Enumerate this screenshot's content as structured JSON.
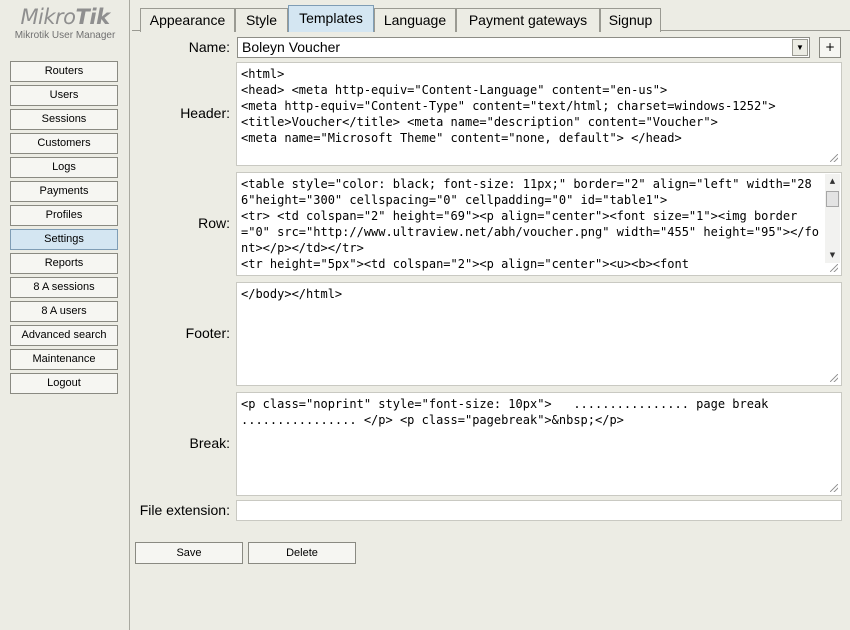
{
  "logo": {
    "brand_prefix": "Mikro",
    "brand_suffix": "Tik",
    "subtitle": "Mikrotik User Manager"
  },
  "sidebar": {
    "items": [
      {
        "label": "Routers"
      },
      {
        "label": "Users"
      },
      {
        "label": "Sessions"
      },
      {
        "label": "Customers"
      },
      {
        "label": "Logs"
      },
      {
        "label": "Payments"
      },
      {
        "label": "Profiles"
      },
      {
        "label": "Settings",
        "active": true
      },
      {
        "label": "Reports"
      },
      {
        "label": "8 A sessions"
      },
      {
        "label": "8 A users"
      },
      {
        "label": "Advanced search"
      },
      {
        "label": "Maintenance"
      },
      {
        "label": "Logout"
      }
    ]
  },
  "tabs": [
    {
      "label": "Appearance"
    },
    {
      "label": "Style"
    },
    {
      "label": "Templates",
      "active": true
    },
    {
      "label": "Language"
    },
    {
      "label": "Payment gateways"
    },
    {
      "label": "Signup"
    }
  ],
  "form": {
    "name_label": "Name:",
    "name_value": "Boleyn Voucher",
    "plus_label": "+",
    "header_label": "Header:",
    "header_value": "<html>\n<head> <meta http-equiv=\"Content-Language\" content=\"en-us\">\n<meta http-equiv=\"Content-Type\" content=\"text/html; charset=windows-1252\">\n<title>Voucher</title> <meta name=\"description\" content=\"Voucher\">\n<meta name=\"Microsoft Theme\" content=\"none, default\"> </head>",
    "row_label": "Row:",
    "row_value": "<table style=\"color: black; font-size: 11px;\" border=\"2\" align=\"left\" width=\"286\"height=\"300\" cellspacing=\"0\" cellpadding=\"0\" id=\"table1\">\n<tr> <td colspan=\"2\" height=\"69\"><p align=\"center\"><font size=\"1\"><img border=\"0\" src=\"http://www.ultraview.net/abh/voucher.png\" width=\"455\" height=\"95\"></font></p></td></tr>\n<tr height=\"5px\"><td colspan=\"2\"><p align=\"center\"><u><b><font",
    "footer_label": "Footer:",
    "footer_value": "</body></html>",
    "break_label": "Break:",
    "break_value": "<p class=\"noprint\" style=\"font-size: 10px\">   ................ page break ................ </p> <p class=\"pagebreak\">&nbsp;</p>",
    "file_ext_label": "File extension:",
    "file_ext_value": "",
    "save_label": "Save",
    "delete_label": "Delete"
  },
  "icons": {
    "dropdown": "chevron-down-icon",
    "scroll_up": "triangle-up-icon",
    "scroll_down": "triangle-down-icon",
    "resize": "resize-grip-icon"
  },
  "colors": {
    "active_tab": "#d4e6f2",
    "background": "#ecece4"
  }
}
